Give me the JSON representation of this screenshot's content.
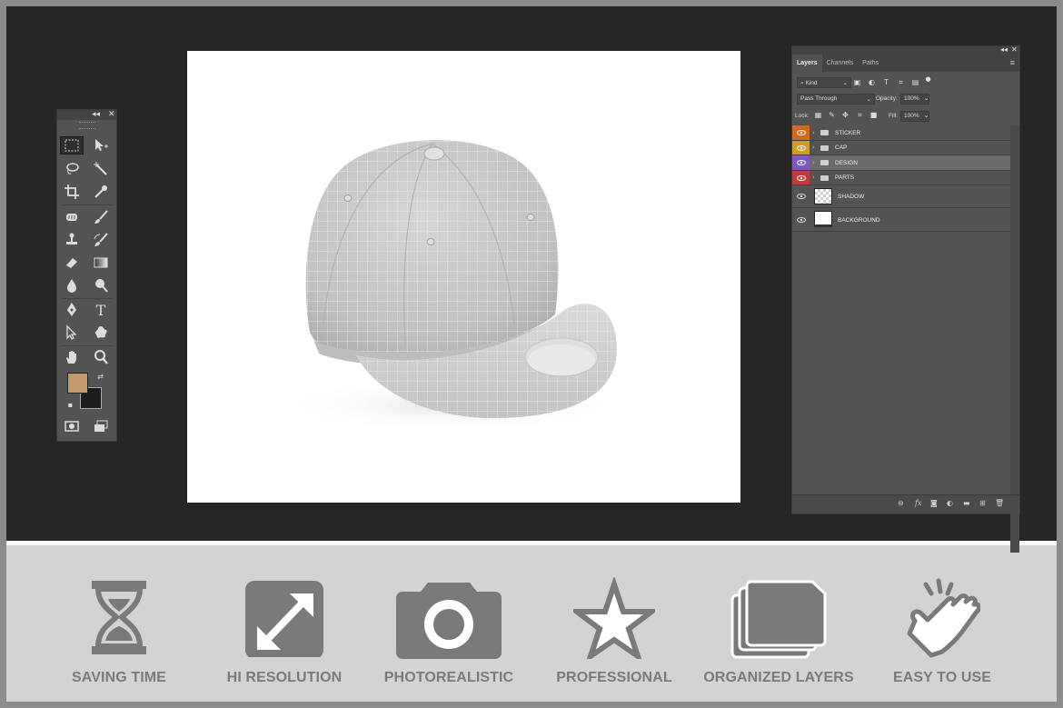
{
  "toolbox": {
    "collapse_label": "◂◂",
    "close_label": "✕",
    "foreground_color": "#c49a6c",
    "background_color": "#1c1c1c",
    "tools": [
      {
        "name": "rectangular-marquee-icon",
        "selected": true
      },
      {
        "name": "move-icon"
      },
      {
        "name": "lasso-icon"
      },
      {
        "name": "magic-wand-icon"
      },
      {
        "name": "crop-icon"
      },
      {
        "name": "eyedropper-icon"
      },
      {
        "name": "spot-healing-icon"
      },
      {
        "name": "brush-icon"
      },
      {
        "name": "clone-stamp-icon"
      },
      {
        "name": "history-brush-icon"
      },
      {
        "name": "eraser-icon"
      },
      {
        "name": "gradient-icon"
      },
      {
        "name": "blur-icon"
      },
      {
        "name": "dodge-icon"
      },
      {
        "name": "pen-icon"
      },
      {
        "name": "type-icon"
      },
      {
        "name": "path-selection-icon"
      },
      {
        "name": "custom-shape-icon"
      },
      {
        "name": "hand-icon"
      },
      {
        "name": "zoom-icon"
      }
    ],
    "type_tool_label": "T"
  },
  "layers_panel": {
    "collapse_label": "◂◂",
    "close_label": "✕",
    "tabs": [
      {
        "label": "Layers",
        "active": true
      },
      {
        "label": "Channels",
        "active": false
      },
      {
        "label": "Paths",
        "active": false
      }
    ],
    "filter_kind": "Kind",
    "blend_mode": "Pass Through",
    "opacity_label": "Opacity:",
    "opacity_value": "100%",
    "lock_label": "Lock:",
    "fill_label": "Fill:",
    "fill_value": "100%",
    "filter_type_label": "T",
    "layers": [
      {
        "name": "STICKER",
        "type": "group",
        "color": "#d2691e",
        "selected": false
      },
      {
        "name": "CAP",
        "type": "group",
        "color": "#c8a02a",
        "selected": false
      },
      {
        "name": "DESIGN",
        "type": "group",
        "color": "#7e57c2",
        "selected": true
      },
      {
        "name": "PARTS",
        "type": "group",
        "color": "#c43a3a",
        "selected": false
      },
      {
        "name": "SHADOW",
        "type": "layer",
        "thumb": "transparent",
        "selected": false
      },
      {
        "name": "BACKGROUND",
        "type": "layer",
        "thumb": "white",
        "selected": false
      }
    ],
    "footer_fx_label": "fx"
  },
  "features": [
    {
      "label": "SAVING TIME",
      "icon": "hourglass-icon"
    },
    {
      "label": "HI RESOLUTION",
      "icon": "expand-icon"
    },
    {
      "label": "PHOTOREALISTIC",
      "icon": "camera-icon"
    },
    {
      "label": "PROFESSIONAL",
      "icon": "star-icon"
    },
    {
      "label": "ORGANIZED LAYERS",
      "icon": "folders-icon"
    },
    {
      "label": "EASY TO USE",
      "icon": "tap-hand-icon"
    }
  ],
  "colors": {
    "feature_icon": "#7a7a7a",
    "workspace": "#262626",
    "panel": "#535353"
  }
}
